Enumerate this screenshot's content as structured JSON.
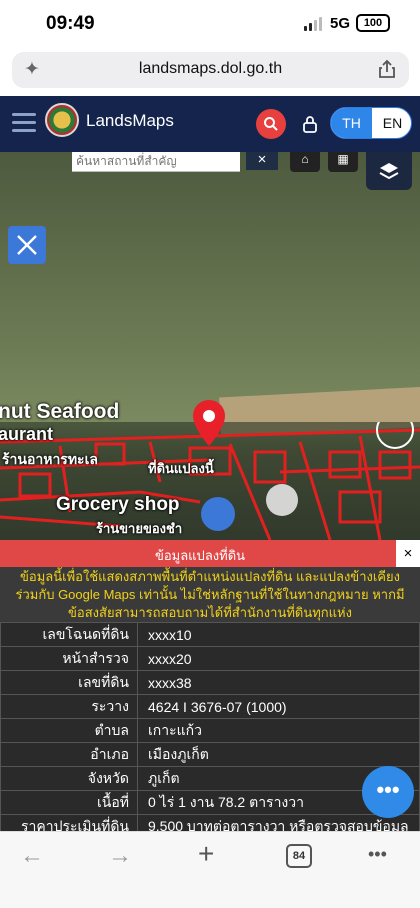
{
  "status": {
    "time": "09:49",
    "network": "5G",
    "battery": "100"
  },
  "browser": {
    "url": "landsmaps.dol.go.th",
    "tab_count": "84"
  },
  "header": {
    "brand": "LandsMaps",
    "lang_th": "TH",
    "lang_en": "EN"
  },
  "map": {
    "search_placeholder": "ค้นหาสถานที่สำคัญ",
    "close": "×",
    "labels": {
      "seafood": "nut Seafood",
      "restaurant": "aurant",
      "thai_rest": "ร้านอาหารทะเล",
      "parcel": "ที่ดินแปลงนี้",
      "grocery": "Grocery shop",
      "grocery_th": "ร้านขายของชำ"
    }
  },
  "panel": {
    "title": "ข้อมูลแปลงที่ดิน",
    "close": "×",
    "notice": "ข้อมูลนี้เพื่อใช้แสดงสภาพพื้นที่ตำแหน่งแปลงที่ดิน และแปลงข้างเคียงร่วมกับ Google Maps เท่านั้น ไม่ใช่หลักฐานที่ใช้ในทางกฎหมาย หากมีข้อสงสัยสามารถสอบถามได้ที่สำนักงานที่ดินทุกแห่ง",
    "rows": [
      {
        "key": "เลขโฉนดที่ดิน",
        "value": "xxxx10"
      },
      {
        "key": "หน้าสำรวจ",
        "value": "xxxx20"
      },
      {
        "key": "เลขที่ดิน",
        "value": "xxxx38"
      },
      {
        "key": "ระวาง",
        "value": "4624 I 3676-07 (1000)"
      },
      {
        "key": "ตำบล",
        "value": "เกาะแก้ว"
      },
      {
        "key": "อำเภอ",
        "value": "เมืองภูเก็ต"
      },
      {
        "key": "จังหวัด",
        "value": "ภูเก็ต"
      },
      {
        "key": "เนื้อที่",
        "value": "0 ไร่ 1 งาน 78.2 ตารางวา"
      },
      {
        "key": "ราคาประเมินที่ดิน",
        "value": "9,500 บาทต่อตารางวา หรือตรวจสอบข้อมูล"
      }
    ],
    "fab": "•••"
  },
  "colors": {
    "header": "#14244c",
    "accent_red": "#e04848",
    "notice_text": "#f2d21a",
    "blue": "#2f8ae8"
  }
}
